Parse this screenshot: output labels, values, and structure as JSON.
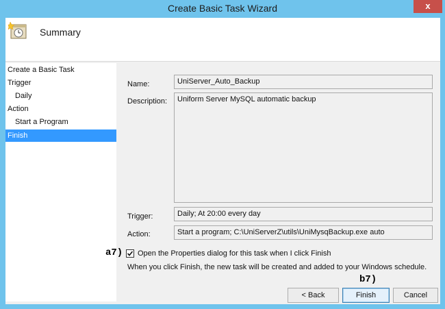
{
  "window": {
    "title": "Create Basic Task Wizard",
    "close_glyph": "x"
  },
  "header": {
    "title": "Summary",
    "icon": "task-clock-icon"
  },
  "nav": {
    "items": [
      {
        "label": "Create a Basic Task",
        "active": false
      },
      {
        "label": "Trigger",
        "active": false
      },
      {
        "label": "Daily",
        "active": false
      },
      {
        "label": "Action",
        "active": false
      },
      {
        "label": "Start a Program",
        "active": false
      },
      {
        "label": "Finish",
        "active": true
      }
    ]
  },
  "form": {
    "name_label": "Name:",
    "name_value": "UniServer_Auto_Backup",
    "description_label": "Description:",
    "description_value": "Uniform Server MySQL automatic backup",
    "trigger_label": "Trigger:",
    "trigger_value": "Daily; At 20:00 every day",
    "action_label": "Action:",
    "action_value": "Start a program; C:\\UniServerZ\\utils\\UniMysqBackup.exe auto"
  },
  "options": {
    "open_properties_label": "Open the Properties dialog for this task when I click Finish",
    "open_properties_checked": true,
    "finish_note": "When you click Finish, the new task will be created and added to your Windows schedule."
  },
  "annotations": {
    "checkbox": "a7)",
    "finish": "b7)"
  },
  "buttons": {
    "back": "< Back",
    "finish": "Finish",
    "cancel": "Cancel"
  },
  "colors": {
    "frame": "#6fc3ec",
    "close": "#c7504a",
    "selection": "#3399ff"
  }
}
